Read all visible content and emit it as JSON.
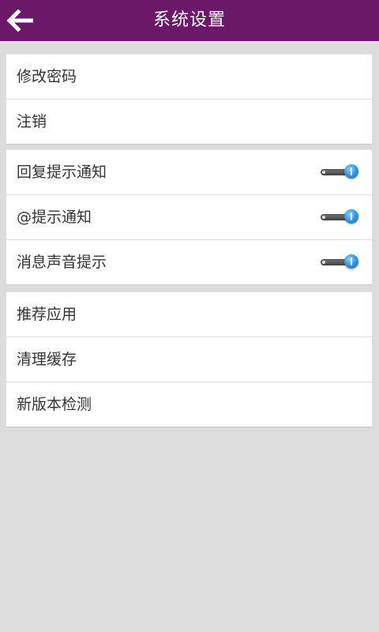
{
  "header": {
    "title": "系统设置",
    "back_icon": "back-arrow-icon",
    "background_color": "#6c1868"
  },
  "groups": [
    {
      "items": [
        {
          "label": "修改密码"
        },
        {
          "label": "注销"
        }
      ]
    },
    {
      "items": [
        {
          "label": "回复提示通知",
          "toggle": true,
          "state": "on"
        },
        {
          "label": "@提示通知",
          "toggle": true,
          "state": "on"
        },
        {
          "label": "消息声音提示",
          "toggle": true,
          "state": "on"
        }
      ]
    },
    {
      "items": [
        {
          "label": "推荐应用"
        },
        {
          "label": "清理缓存"
        },
        {
          "label": "新版本检测"
        }
      ]
    }
  ],
  "colors": {
    "page_background": "#dcdcdc",
    "toggle_accent": "#2d8fd8"
  }
}
